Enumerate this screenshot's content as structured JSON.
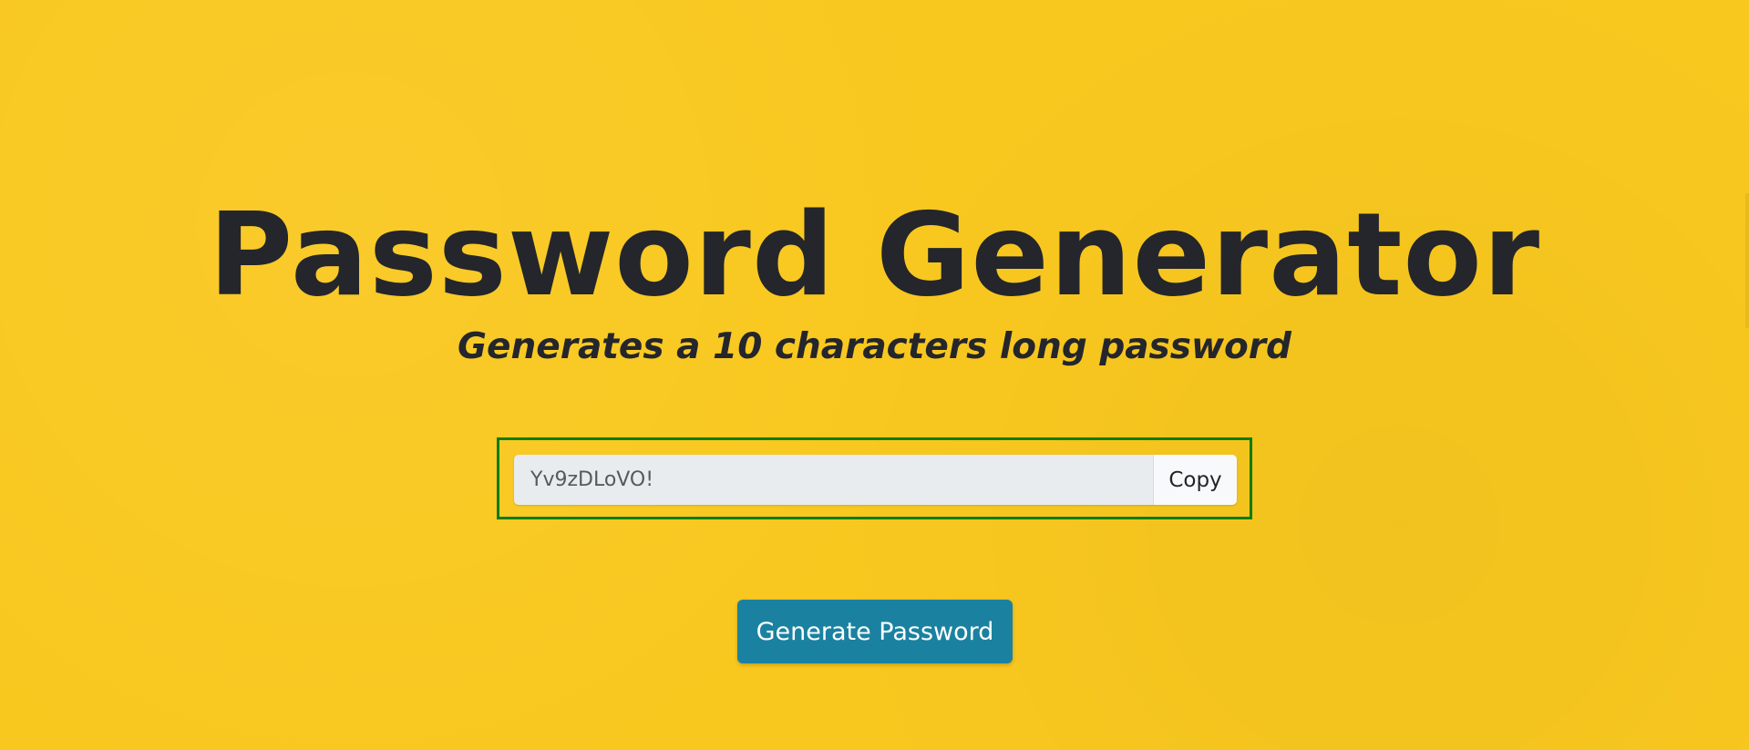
{
  "header": {
    "title": "Password Generator",
    "subtitle": "Generates a 10 characters long password"
  },
  "password": {
    "value": "Yv9zDLoVO!",
    "copy_label": "Copy"
  },
  "actions": {
    "generate_label": "Generate Password"
  },
  "colors": {
    "background": "#f9c81f",
    "frame_border": "#0e7d12",
    "primary_button": "#1a82a0",
    "text": "#24262b"
  }
}
